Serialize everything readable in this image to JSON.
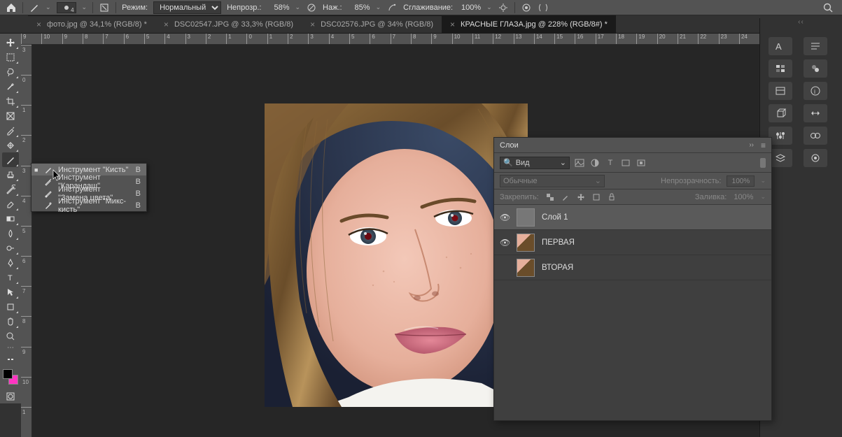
{
  "options_bar": {
    "mode_label": "Режим:",
    "mode_value": "Нормальный",
    "opacity_label": "Непрозр.:",
    "opacity_value": "58%",
    "pressure_label": "Наж.:",
    "pressure_value": "85%",
    "smoothing_label": "Сглаживание:",
    "smoothing_value": "100%",
    "brush_size": "4"
  },
  "tabs": [
    {
      "label": "фото.jpg @ 34,1% (RGB/8) *",
      "active": false
    },
    {
      "label": "DSC02547.JPG @ 33,3% (RGB/8)",
      "active": false
    },
    {
      "label": "DSC02576.JPG @ 34% (RGB/8)",
      "active": false
    },
    {
      "label": "КРАСНЫЕ ГЛАЗА.jpg @ 228% (RGB/8#) *",
      "active": true
    }
  ],
  "flyout": {
    "items": [
      {
        "name": "Инструмент \"Кисть\"",
        "shortcut": "B",
        "selected": true
      },
      {
        "name": "Инструмент \"Карандаш\"",
        "shortcut": "B",
        "selected": false
      },
      {
        "name": "Инструмент \"Замена цвета\"",
        "shortcut": "B",
        "selected": false
      },
      {
        "name": "Инструмент \"Микс-кисть\"",
        "shortcut": "B",
        "selected": false
      }
    ]
  },
  "ruler_h": [
    "9",
    "10",
    "9",
    "8",
    "7",
    "6",
    "5",
    "4",
    "3",
    "2",
    "1",
    "0",
    "1",
    "2",
    "3",
    "4",
    "5",
    "6",
    "7",
    "8",
    "9",
    "10",
    "11",
    "12",
    "13",
    "14",
    "15",
    "16",
    "17",
    "18",
    "19",
    "20",
    "21",
    "22",
    "23",
    "24"
  ],
  "ruler_v": [
    "3",
    "0",
    "1",
    "2",
    "3",
    "4",
    "5",
    "6",
    "7",
    "8",
    "9",
    "10",
    "1"
  ],
  "layers_panel": {
    "title": "Слои",
    "filter_label": "Вид",
    "blend_mode": "Обычные",
    "opacity_label": "Непрозрачность:",
    "opacity_value": "100%",
    "lock_label": "Закрепить:",
    "fill_label": "Заливка:",
    "fill_value": "100%",
    "layers": [
      {
        "name": "Слой 1",
        "visible": true,
        "selected": true,
        "thumb": "checker"
      },
      {
        "name": "ПЕРВАЯ",
        "visible": true,
        "selected": false,
        "thumb": "face"
      },
      {
        "name": "ВТОРАЯ",
        "visible": false,
        "selected": false,
        "thumb": "face"
      }
    ]
  },
  "colors": {
    "fg": "#000000",
    "bg": "#ff34c2"
  }
}
